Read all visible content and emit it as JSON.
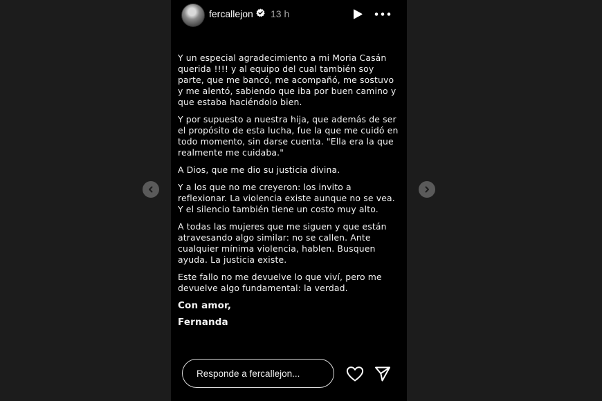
{
  "header": {
    "username": "fercallejon",
    "time": "13 h"
  },
  "content": {
    "paragraphs": [
      "Y un especial agradecimiento a mi Moria Casán\nquerida !!!! y al equipo del cual también soy\nparte, que me bancó, me acompañó, me sostuvo\ny me alentó, sabiendo que iba por buen camino y\nque estaba haciéndolo bien.",
      "Y por supuesto a nuestra hija, que además de ser\nel propósito de esta lucha, fue la que me cuidó en\ntodo momento, sin darse cuenta. \"Ella era la que\nrealmente me cuidaba.\"",
      "A Dios, que me dio su justicia divina.",
      "Y a los que no me creyeron: los invito a\nreflexionar. La violencia existe aunque no se vea.\nY el silencio también tiene un costo muy alto.",
      "A todas las mujeres que me siguen y que están\natravesando algo similar: no se callen. Ante\ncualquier mínima violencia, hablen. Busquen\nayuda. La justicia existe.",
      "Este fallo no me devuelve lo que viví, pero me\ndevuelve algo fundamental: la verdad."
    ],
    "closing": "Con amor,",
    "signature": "Fernanda"
  },
  "footer": {
    "reply_placeholder": "Responde a fercallejon..."
  },
  "icons": {
    "avatar": "avatar",
    "verified": "verified-badge-icon",
    "play": "play-icon",
    "more": "more-options-icon",
    "heart": "heart-icon",
    "send": "send-icon",
    "prev": "chevron-left-icon",
    "next": "chevron-right-icon"
  },
  "colors": {
    "page_background": "#1c1c1c",
    "story_background": "#000000",
    "text": "#ffffff",
    "muted_text": "#a8a8a8",
    "nav_arrow": "#5a5a5a"
  }
}
